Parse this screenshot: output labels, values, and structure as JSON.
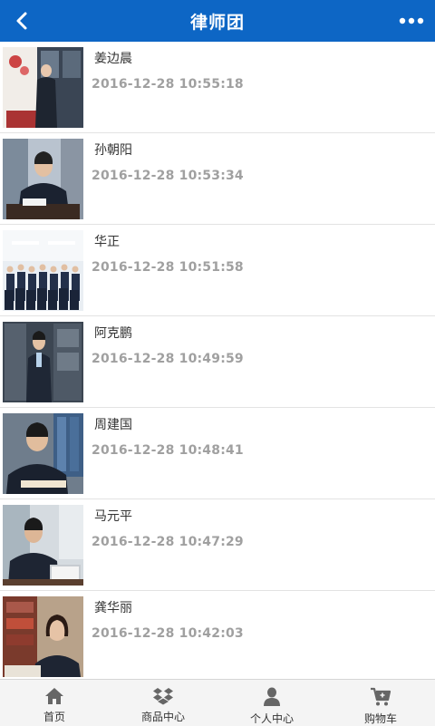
{
  "header": {
    "title": "律师团"
  },
  "lawyers": [
    {
      "name": "姜边晨",
      "time": "2016-12-28 10:55:18"
    },
    {
      "name": "孙朝阳",
      "time": "2016-12-28 10:53:34"
    },
    {
      "name": "华正",
      "time": "2016-12-28 10:51:58"
    },
    {
      "name": "阿克鹏",
      "time": "2016-12-28 10:49:59"
    },
    {
      "name": "周建国",
      "time": "2016-12-28 10:48:41"
    },
    {
      "name": "马元平",
      "time": "2016-12-28 10:47:29"
    },
    {
      "name": "龚华丽",
      "time": "2016-12-28 10:42:03"
    }
  ],
  "tabbar": {
    "tabs": [
      {
        "label": "首页",
        "icon": "home-icon"
      },
      {
        "label": "商品中心",
        "icon": "dropbox-icon"
      },
      {
        "label": "个人中心",
        "icon": "user-icon"
      },
      {
        "label": "购物车",
        "icon": "cart-icon"
      }
    ]
  },
  "colors": {
    "header_bg": "#0d66c5",
    "time_text": "#a0a0a0",
    "tab_icon": "#666666"
  }
}
